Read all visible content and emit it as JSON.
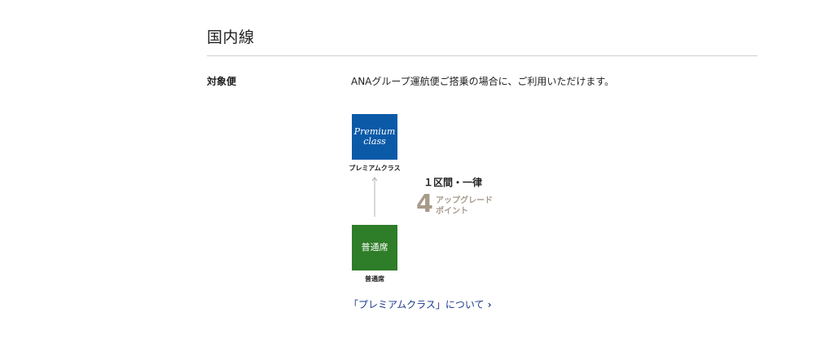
{
  "section": {
    "title": "国内線"
  },
  "row": {
    "label": "対象便",
    "value": "ANAグループ運航便ご搭乗の場合に、ご利用いただけます。"
  },
  "premium": {
    "logo_line1": "Premium",
    "logo_line2": "class",
    "caption": "プレミアムクラス",
    "color": "#0b5aa8"
  },
  "standard": {
    "box_text": "普通席",
    "caption": "普通席",
    "color": "#2e7d28"
  },
  "upgrade": {
    "per_segment": "１区間・一律",
    "points": "4",
    "points_label_line1": "アップグレード",
    "points_label_line2": "ポイント",
    "color": "#a89a8a"
  },
  "link": {
    "text": "「プレミアムクラス」について",
    "icon": "chevron-right-icon"
  }
}
